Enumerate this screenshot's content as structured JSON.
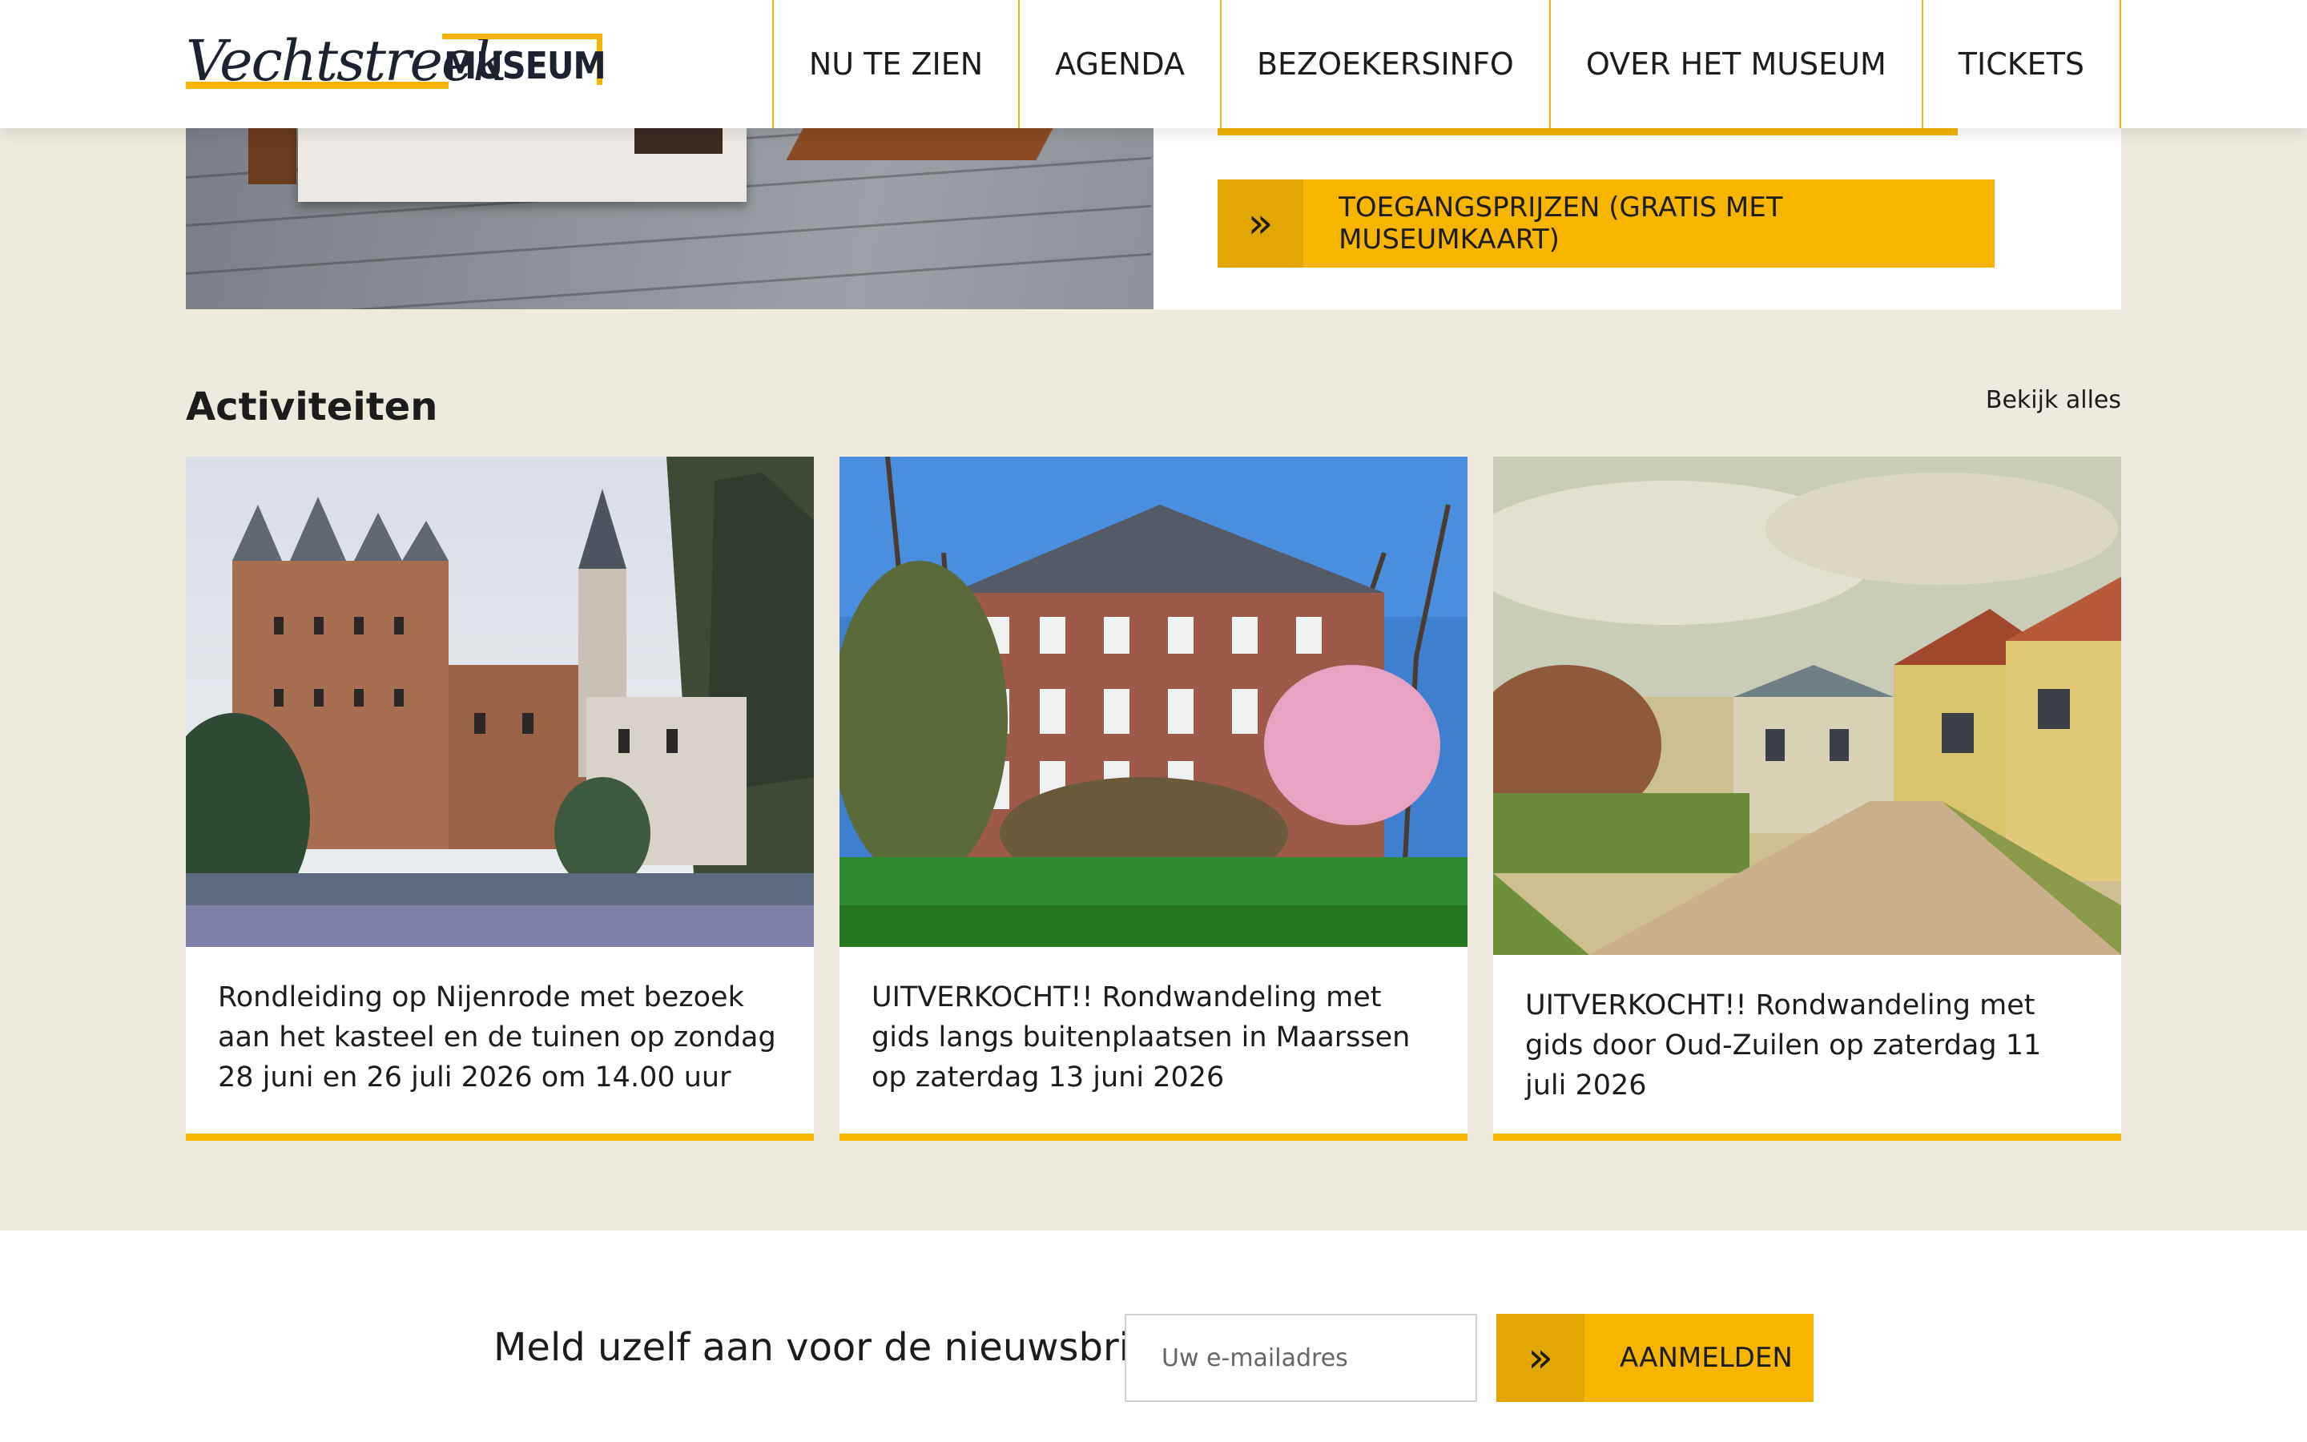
{
  "header": {
    "logo_script": "Vechtstreek",
    "logo_box": "MUSEUM",
    "nav": [
      "NU TE ZIEN",
      "AGENDA",
      "BEZOEKERSINFO",
      "OVER HET MUSEUM",
      "TICKETS"
    ]
  },
  "info": {
    "cta_chevron": "»",
    "cta_label": "TOEGANGSPRIJZEN (GRATIS MET MUSEUMKAART)"
  },
  "activities": {
    "title": "Activiteiten",
    "view_all": "Bekijk alles",
    "cards": [
      {
        "text": "Rondleiding op Nijenrode met bezoek aan het kasteel en de tuinen op zondag 28 juni en 26 juli 2026 om 14.00 uur"
      },
      {
        "text": "UITVERKOCHT!! Rondwandeling met gids langs buitenplaatsen in Maarssen op zaterdag 13 juni 2026"
      },
      {
        "text": "UITVERKOCHT!! Rondwandeling met gids door Oud-Zuilen op zaterdag 11 juli 2026"
      }
    ]
  },
  "newsletter": {
    "label": "Meld uzelf aan voor de nieuwsbrief",
    "placeholder": "Uw e-mailadres",
    "button_chevron": "»",
    "button_label": "AANMELDEN"
  },
  "colors": {
    "accent": "#f7b500",
    "accent_dark": "#e3a500",
    "background": "#efeade"
  }
}
